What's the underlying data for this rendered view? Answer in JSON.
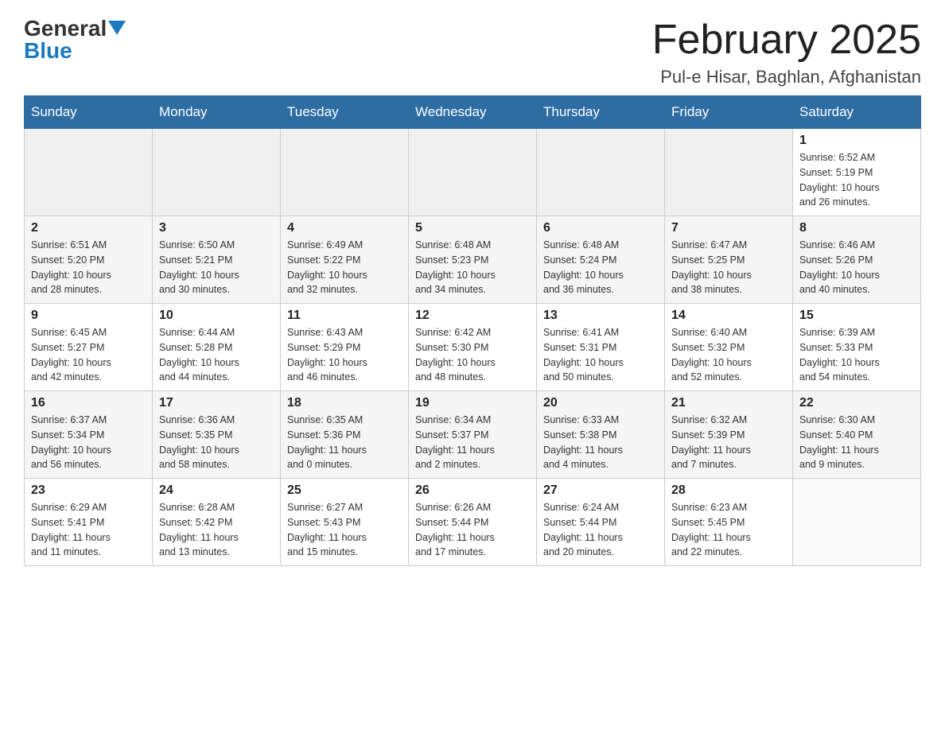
{
  "header": {
    "logo_general": "General",
    "logo_blue": "Blue",
    "title": "February 2025",
    "location": "Pul-e Hisar, Baghlan, Afghanistan"
  },
  "weekdays": [
    "Sunday",
    "Monday",
    "Tuesday",
    "Wednesday",
    "Thursday",
    "Friday",
    "Saturday"
  ],
  "weeks": [
    {
      "days": [
        {
          "date": "",
          "info": ""
        },
        {
          "date": "",
          "info": ""
        },
        {
          "date": "",
          "info": ""
        },
        {
          "date": "",
          "info": ""
        },
        {
          "date": "",
          "info": ""
        },
        {
          "date": "",
          "info": ""
        },
        {
          "date": "1",
          "info": "Sunrise: 6:52 AM\nSunset: 5:19 PM\nDaylight: 10 hours\nand 26 minutes."
        }
      ]
    },
    {
      "days": [
        {
          "date": "2",
          "info": "Sunrise: 6:51 AM\nSunset: 5:20 PM\nDaylight: 10 hours\nand 28 minutes."
        },
        {
          "date": "3",
          "info": "Sunrise: 6:50 AM\nSunset: 5:21 PM\nDaylight: 10 hours\nand 30 minutes."
        },
        {
          "date": "4",
          "info": "Sunrise: 6:49 AM\nSunset: 5:22 PM\nDaylight: 10 hours\nand 32 minutes."
        },
        {
          "date": "5",
          "info": "Sunrise: 6:48 AM\nSunset: 5:23 PM\nDaylight: 10 hours\nand 34 minutes."
        },
        {
          "date": "6",
          "info": "Sunrise: 6:48 AM\nSunset: 5:24 PM\nDaylight: 10 hours\nand 36 minutes."
        },
        {
          "date": "7",
          "info": "Sunrise: 6:47 AM\nSunset: 5:25 PM\nDaylight: 10 hours\nand 38 minutes."
        },
        {
          "date": "8",
          "info": "Sunrise: 6:46 AM\nSunset: 5:26 PM\nDaylight: 10 hours\nand 40 minutes."
        }
      ]
    },
    {
      "days": [
        {
          "date": "9",
          "info": "Sunrise: 6:45 AM\nSunset: 5:27 PM\nDaylight: 10 hours\nand 42 minutes."
        },
        {
          "date": "10",
          "info": "Sunrise: 6:44 AM\nSunset: 5:28 PM\nDaylight: 10 hours\nand 44 minutes."
        },
        {
          "date": "11",
          "info": "Sunrise: 6:43 AM\nSunset: 5:29 PM\nDaylight: 10 hours\nand 46 minutes."
        },
        {
          "date": "12",
          "info": "Sunrise: 6:42 AM\nSunset: 5:30 PM\nDaylight: 10 hours\nand 48 minutes."
        },
        {
          "date": "13",
          "info": "Sunrise: 6:41 AM\nSunset: 5:31 PM\nDaylight: 10 hours\nand 50 minutes."
        },
        {
          "date": "14",
          "info": "Sunrise: 6:40 AM\nSunset: 5:32 PM\nDaylight: 10 hours\nand 52 minutes."
        },
        {
          "date": "15",
          "info": "Sunrise: 6:39 AM\nSunset: 5:33 PM\nDaylight: 10 hours\nand 54 minutes."
        }
      ]
    },
    {
      "days": [
        {
          "date": "16",
          "info": "Sunrise: 6:37 AM\nSunset: 5:34 PM\nDaylight: 10 hours\nand 56 minutes."
        },
        {
          "date": "17",
          "info": "Sunrise: 6:36 AM\nSunset: 5:35 PM\nDaylight: 10 hours\nand 58 minutes."
        },
        {
          "date": "18",
          "info": "Sunrise: 6:35 AM\nSunset: 5:36 PM\nDaylight: 11 hours\nand 0 minutes."
        },
        {
          "date": "19",
          "info": "Sunrise: 6:34 AM\nSunset: 5:37 PM\nDaylight: 11 hours\nand 2 minutes."
        },
        {
          "date": "20",
          "info": "Sunrise: 6:33 AM\nSunset: 5:38 PM\nDaylight: 11 hours\nand 4 minutes."
        },
        {
          "date": "21",
          "info": "Sunrise: 6:32 AM\nSunset: 5:39 PM\nDaylight: 11 hours\nand 7 minutes."
        },
        {
          "date": "22",
          "info": "Sunrise: 6:30 AM\nSunset: 5:40 PM\nDaylight: 11 hours\nand 9 minutes."
        }
      ]
    },
    {
      "days": [
        {
          "date": "23",
          "info": "Sunrise: 6:29 AM\nSunset: 5:41 PM\nDaylight: 11 hours\nand 11 minutes."
        },
        {
          "date": "24",
          "info": "Sunrise: 6:28 AM\nSunset: 5:42 PM\nDaylight: 11 hours\nand 13 minutes."
        },
        {
          "date": "25",
          "info": "Sunrise: 6:27 AM\nSunset: 5:43 PM\nDaylight: 11 hours\nand 15 minutes."
        },
        {
          "date": "26",
          "info": "Sunrise: 6:26 AM\nSunset: 5:44 PM\nDaylight: 11 hours\nand 17 minutes."
        },
        {
          "date": "27",
          "info": "Sunrise: 6:24 AM\nSunset: 5:44 PM\nDaylight: 11 hours\nand 20 minutes."
        },
        {
          "date": "28",
          "info": "Sunrise: 6:23 AM\nSunset: 5:45 PM\nDaylight: 11 hours\nand 22 minutes."
        },
        {
          "date": "",
          "info": ""
        }
      ]
    }
  ]
}
